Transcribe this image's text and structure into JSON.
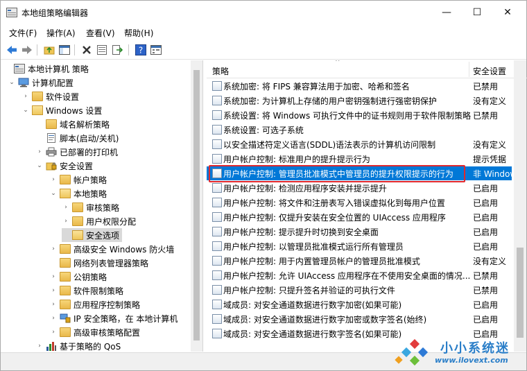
{
  "window": {
    "title": "本地组策略编辑器",
    "controls": {
      "minimize": "—",
      "maximize": "☐",
      "close": "✕"
    }
  },
  "menu": [
    "文件(F)",
    "操作(A)",
    "查看(V)",
    "帮助(H)"
  ],
  "toolbar": [
    "back-icon",
    "forward-icon",
    "up-folder-icon",
    "show-hide-tree-icon",
    "delete-icon",
    "properties-icon",
    "export-icon",
    "help-icon",
    "view-icon"
  ],
  "tree": [
    {
      "label": "本地计算机 策略",
      "exp": "",
      "icon": "computer-policy",
      "level": 0
    },
    {
      "label": "计算机配置",
      "exp": "⌄",
      "icon": "computer",
      "level": 1
    },
    {
      "label": "软件设置",
      "exp": "›",
      "icon": "folder",
      "level": 2
    },
    {
      "label": "Windows 设置",
      "exp": "⌄",
      "icon": "folder-open",
      "level": 2
    },
    {
      "label": "域名解析策略",
      "exp": "",
      "icon": "folder",
      "level": 3
    },
    {
      "label": "脚本(启动/关机)",
      "exp": "",
      "icon": "script",
      "level": 3
    },
    {
      "label": "已部署的打印机",
      "exp": "›",
      "icon": "printer",
      "level": 3
    },
    {
      "label": "安全设置",
      "exp": "⌄",
      "icon": "security",
      "level": 3
    },
    {
      "label": "帐户策略",
      "exp": "›",
      "icon": "folder",
      "level": 4
    },
    {
      "label": "本地策略",
      "exp": "⌄",
      "icon": "folder-open",
      "level": 4
    },
    {
      "label": "审核策略",
      "exp": "›",
      "icon": "folder",
      "level": 5
    },
    {
      "label": "用户权限分配",
      "exp": "›",
      "icon": "folder",
      "level": 5
    },
    {
      "label": "安全选项",
      "exp": "",
      "icon": "folder-open",
      "level": 5,
      "selected": true
    },
    {
      "label": "高级安全 Windows 防火墙",
      "exp": "›",
      "icon": "folder",
      "level": 4
    },
    {
      "label": "网络列表管理器策略",
      "exp": "",
      "icon": "folder",
      "level": 4
    },
    {
      "label": "公钥策略",
      "exp": "›",
      "icon": "folder",
      "level": 4
    },
    {
      "label": "软件限制策略",
      "exp": "›",
      "icon": "folder",
      "level": 4
    },
    {
      "label": "应用程序控制策略",
      "exp": "›",
      "icon": "folder",
      "level": 4
    },
    {
      "label": "IP 安全策略，在 本地计算机",
      "exp": "›",
      "icon": "ipsec",
      "level": 4
    },
    {
      "label": "高级审核策略配置",
      "exp": "›",
      "icon": "folder",
      "level": 4
    },
    {
      "label": "基于策略的 QoS",
      "exp": "›",
      "icon": "chart",
      "level": 3
    }
  ],
  "list": {
    "headers": {
      "policy": "策略",
      "setting": "安全设置"
    },
    "rows": [
      {
        "name": "系统加密: 将 FIPS 兼容算法用于加密、哈希和签名",
        "value": "已禁用"
      },
      {
        "name": "系统加密: 为计算机上存储的用户密钥强制进行强密钥保护",
        "value": "没有定义"
      },
      {
        "name": "系统设置: 将 Windows 可执行文件中的证书规则用于软件限制策略",
        "value": "已禁用"
      },
      {
        "name": "系统设置: 可选子系统",
        "value": ""
      },
      {
        "name": "以安全描述符定义语言(SDDL)语法表示的计算机访问限制",
        "value": "没有定义"
      },
      {
        "name": "用户帐户控制: 标准用户的提升提示行为",
        "value": "提示凭据"
      },
      {
        "name": "用户帐户控制: 管理员批准模式中管理员的提升权限提示的行为",
        "value": "非 Windows",
        "selected": true
      },
      {
        "name": "用户帐户控制: 检测应用程序安装并提示提升",
        "value": "已启用"
      },
      {
        "name": "用户帐户控制: 将文件和注册表写入错误虚拟化到每用户位置",
        "value": "已启用"
      },
      {
        "name": "用户帐户控制: 仅提升安装在安全位置的 UIAccess 应用程序",
        "value": "已启用"
      },
      {
        "name": "用户帐户控制: 提示提升时切换到安全桌面",
        "value": "已启用"
      },
      {
        "name": "用户帐户控制: 以管理员批准模式运行所有管理员",
        "value": "已启用"
      },
      {
        "name": "用户帐户控制: 用于内置管理员帐户的管理员批准模式",
        "value": "没有定义"
      },
      {
        "name": "用户帐户控制: 允许 UIAccess 应用程序在不使用安全桌面的情况...",
        "value": "已禁用"
      },
      {
        "name": "用户帐户控制: 只提升签名并验证的可执行文件",
        "value": "已禁用"
      },
      {
        "name": "域成员: 对安全通道数据进行数字加密(如果可能)",
        "value": "已启用"
      },
      {
        "name": "域成员: 对安全通道数据进行数字加密或数字签名(始终)",
        "value": "已启用"
      },
      {
        "name": "域成员: 对安全通道数据进行数字签名(如果可能)",
        "value": "已启用"
      }
    ]
  },
  "watermark": {
    "title": "小小系统迷",
    "url": "www.ilovext.com"
  }
}
